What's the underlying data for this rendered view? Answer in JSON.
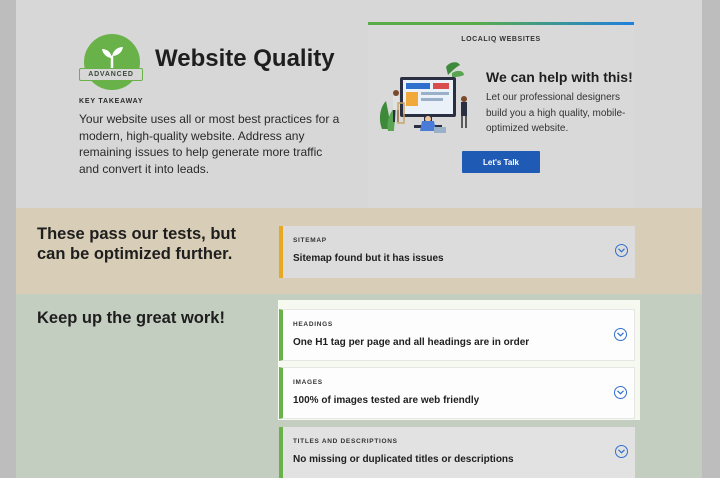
{
  "header": {
    "badge_label": "ADVANCED",
    "title": "Website Quality",
    "key_takeaway_label": "KEY TAKEAWAY",
    "description": "Your website uses all or most best practices for a modern, high-quality website. Address any remaining issues to help generate more traffic and convert it into leads."
  },
  "promo": {
    "kicker": "LOCALIQ WEBSITES",
    "heading": "We can help with this!",
    "body": "Let our professional designers build you a high quality, mobile-optimized website.",
    "button_label": "Let's Talk"
  },
  "optimize": {
    "heading": "These pass our tests, but can be optimized further.",
    "items": [
      {
        "kicker": "SITEMAP",
        "text": "Sitemap found but it has issues"
      }
    ]
  },
  "great": {
    "heading": "Keep up the great work!",
    "items": [
      {
        "kicker": "HEADINGS",
        "text": "One H1 tag per page and all headings are in order"
      },
      {
        "kicker": "IMAGES",
        "text": "100% of images tested are web friendly"
      },
      {
        "kicker": "TITLES AND DESCRIPTIONS",
        "text": "No missing or duplicated titles or descriptions"
      }
    ]
  },
  "colors": {
    "good": "#69b24a",
    "warning": "#e8a822",
    "link": "#2f6fce",
    "button": "#1f5ab5"
  },
  "icons": [
    "sprout-icon",
    "chevron-down-icon"
  ]
}
